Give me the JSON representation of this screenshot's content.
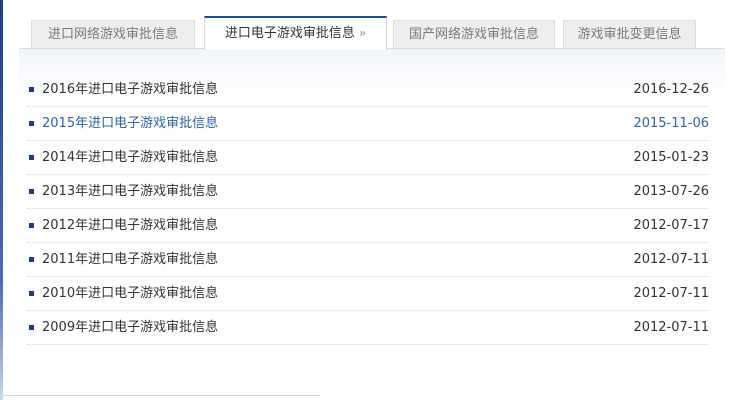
{
  "tabs": [
    {
      "label": "进口网络游戏审批信息",
      "active": false
    },
    {
      "label": "进口电子游戏审批信息",
      "active": true,
      "chevron": "»"
    },
    {
      "label": "国产网络游戏审批信息",
      "active": false
    },
    {
      "label": "游戏审批变更信息",
      "active": false
    }
  ],
  "items": [
    {
      "title": "2016年进口电子游戏审批信息",
      "date": "2016-12-26"
    },
    {
      "title": "2015年进口电子游戏审批信息",
      "date": "2015-11-06",
      "highlight": true
    },
    {
      "title": "2014年进口电子游戏审批信息",
      "date": "2015-01-23"
    },
    {
      "title": "2013年进口电子游戏审批信息",
      "date": "2013-07-26"
    },
    {
      "title": "2012年进口电子游戏审批信息",
      "date": "2012-07-17"
    },
    {
      "title": "2011年进口电子游戏审批信息",
      "date": "2012-07-11"
    },
    {
      "title": "2010年进口电子游戏审批信息",
      "date": "2012-07-11"
    },
    {
      "title": "2009年进口电子游戏审批信息",
      "date": "2012-07-11"
    }
  ],
  "colors": {
    "accent": "#1d4c8f",
    "highlight_text": "#2f62a8",
    "bullet": "#1f3f7a"
  }
}
